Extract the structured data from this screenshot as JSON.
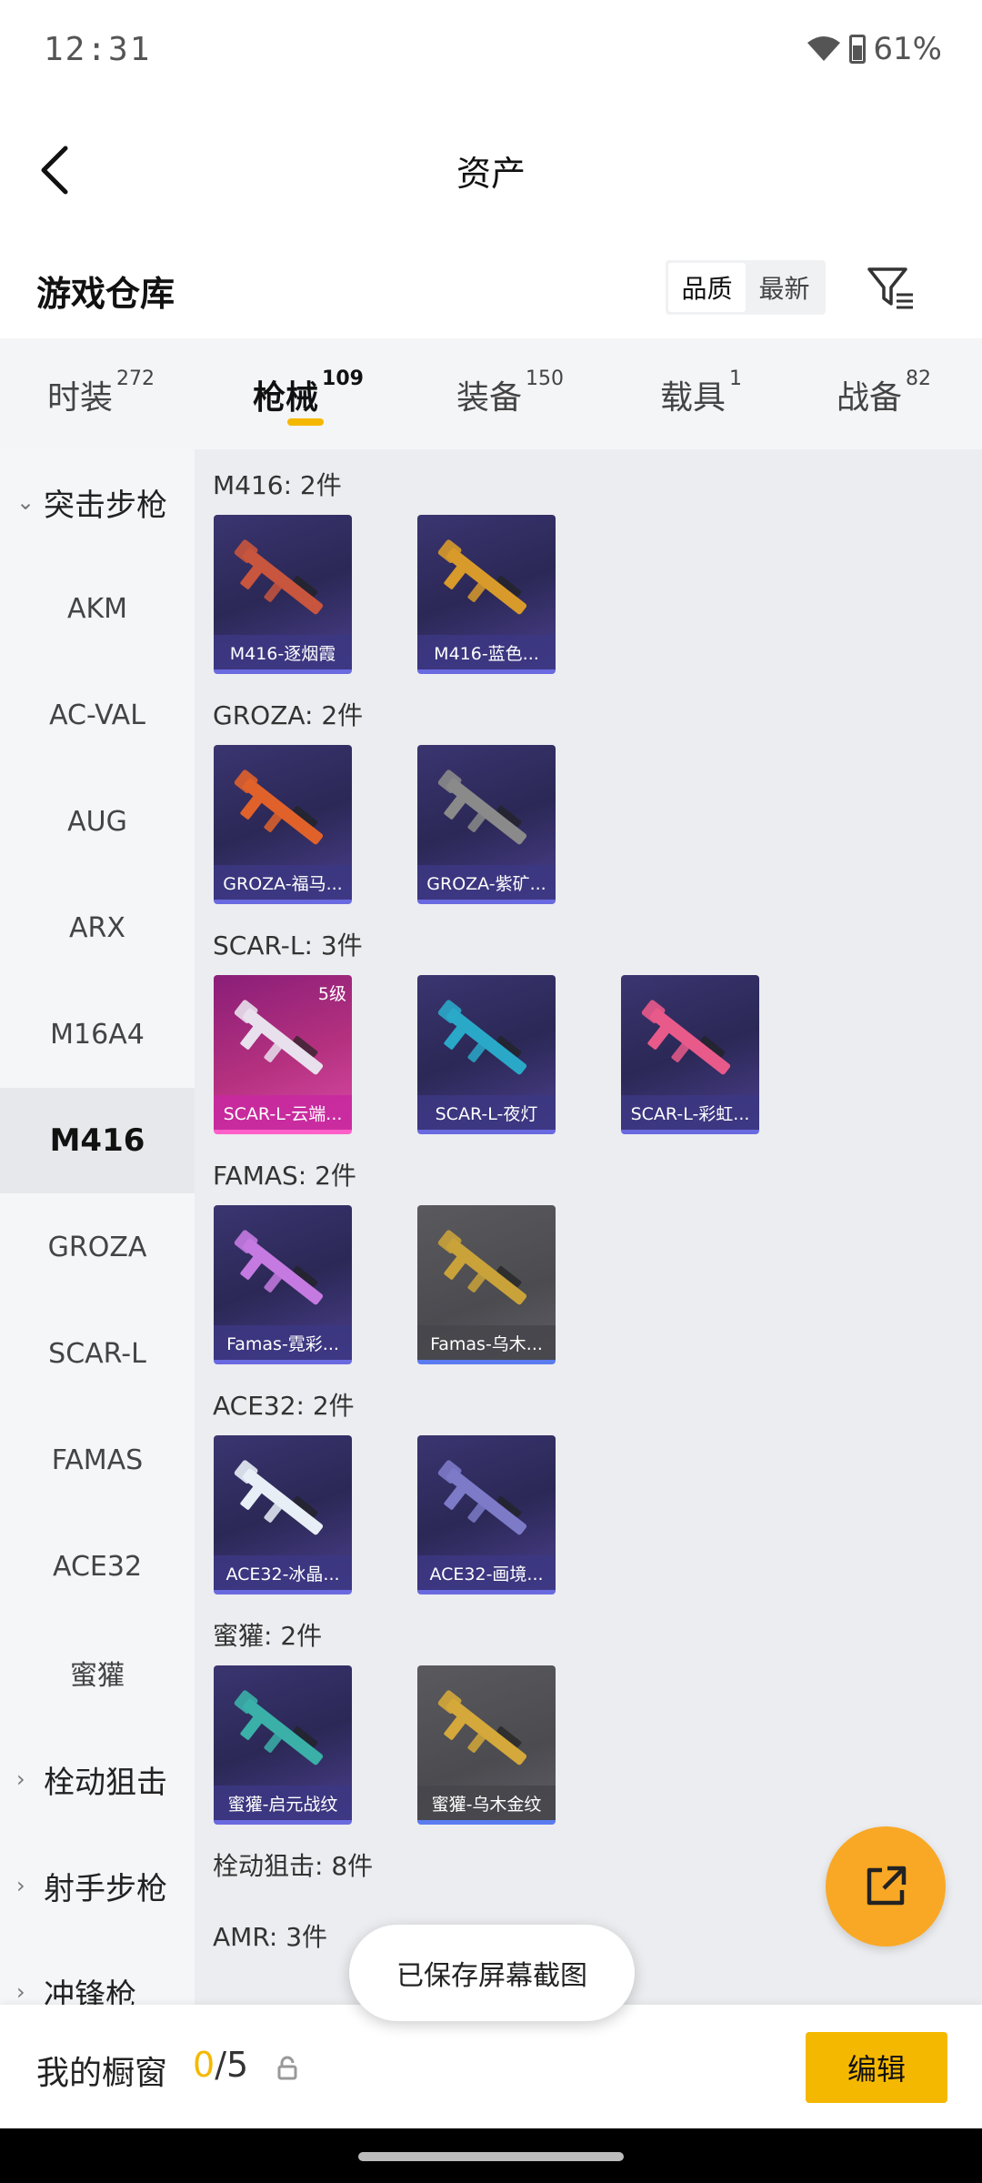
{
  "status": {
    "time": "12:31",
    "battery": "61%"
  },
  "header": {
    "title": "资产"
  },
  "warehouse": {
    "title": "游戏仓库",
    "sort_quality": "品质",
    "sort_newest": "最新"
  },
  "tabs": [
    {
      "label": "时装",
      "count": "272"
    },
    {
      "label": "枪械",
      "count": "109",
      "active": true
    },
    {
      "label": "装备",
      "count": "150"
    },
    {
      "label": "载具",
      "count": "1"
    },
    {
      "label": "战备",
      "count": "82"
    }
  ],
  "sidebar": {
    "items": [
      {
        "label": "突击步枪",
        "group": true,
        "expanded": true
      },
      {
        "label": "AKM"
      },
      {
        "label": "AC-VAL"
      },
      {
        "label": "AUG"
      },
      {
        "label": "ARX"
      },
      {
        "label": "M16A4"
      },
      {
        "label": "M416",
        "active": true
      },
      {
        "label": "GROZA"
      },
      {
        "label": "SCAR-L"
      },
      {
        "label": "FAMAS"
      },
      {
        "label": "ACE32"
      },
      {
        "label": "蜜獾"
      },
      {
        "label": "栓动狙击",
        "group": true
      },
      {
        "label": "射手步枪",
        "group": true
      },
      {
        "label": "冲锋枪",
        "group": true
      }
    ]
  },
  "sections": [
    {
      "title": "M416: 2件",
      "cards": [
        {
          "label": "M416-逐烟霞",
          "style": "purple",
          "gun": "#c8553d"
        },
        {
          "label": "M416-蓝色...",
          "style": "purple",
          "gun": "#d89a2a"
        }
      ]
    },
    {
      "title": "GROZA: 2件",
      "cards": [
        {
          "label": "GROZA-福马...",
          "style": "purple",
          "gun": "#e0622a"
        },
        {
          "label": "GROZA-紫矿...",
          "style": "purple",
          "gun": "#8a8a8a"
        }
      ]
    },
    {
      "title": "SCAR-L: 3件",
      "cards": [
        {
          "label": "SCAR-L-云端...",
          "style": "pink",
          "gun": "#e8e0ec",
          "level": "5级"
        },
        {
          "label": "SCAR-L-夜灯",
          "style": "purple",
          "gun": "#2aa8c8"
        },
        {
          "label": "SCAR-L-彩虹...",
          "style": "purple",
          "gun": "#e85a8a"
        }
      ]
    },
    {
      "title": "FAMAS: 2件",
      "cards": [
        {
          "label": "Famas-霓彩...",
          "style": "purple",
          "gun": "#c47ae0"
        },
        {
          "label": "Famas-乌木...",
          "style": "gray",
          "gun": "#c9a23a"
        }
      ]
    },
    {
      "title": "ACE32: 2件",
      "cards": [
        {
          "label": "ACE32-冰晶...",
          "style": "purple",
          "gun": "#e8eef6"
        },
        {
          "label": "ACE32-画境...",
          "style": "purple",
          "gun": "#7d7ac8"
        }
      ]
    },
    {
      "title": "蜜獾: 2件",
      "cards": [
        {
          "label": "蜜獾-启元战纹",
          "style": "purple",
          "gun": "#3ab0a8"
        },
        {
          "label": "蜜獾-乌木金纹",
          "style": "gray",
          "gun": "#d4a83a"
        }
      ]
    },
    {
      "title": "栓动狙击: 8件",
      "cards": []
    },
    {
      "title": "AMR: 3件",
      "cards": []
    }
  ],
  "toast": "已保存屏幕截图",
  "bottom": {
    "showcase_label": "我的橱窗",
    "showcase_current": "0",
    "showcase_total": "/5",
    "edit_label": "编辑"
  },
  "colors": {
    "accent": "#f5b800",
    "fab": "#f9a825"
  },
  "icons": {
    "back": "back-arrow-icon",
    "filter": "filter-icon",
    "share": "share-external-icon",
    "lock": "lock-icon"
  }
}
